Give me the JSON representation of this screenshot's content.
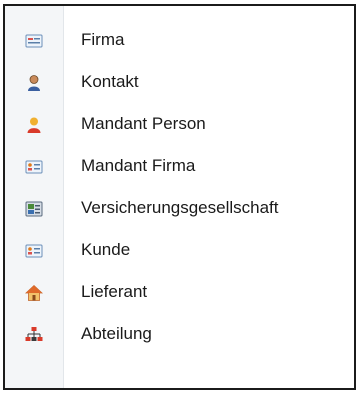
{
  "menu": {
    "items": [
      {
        "label": "Firma",
        "icon": "company-card-icon"
      },
      {
        "label": "Kontakt",
        "icon": "person-icon"
      },
      {
        "label": "Mandant Person",
        "icon": "client-person-icon"
      },
      {
        "label": "Mandant Firma",
        "icon": "client-company-card-icon"
      },
      {
        "label": "Versicherungsgesellschaft",
        "icon": "insurance-company-icon"
      },
      {
        "label": "Kunde",
        "icon": "customer-card-icon"
      },
      {
        "label": "Lieferant",
        "icon": "supplier-house-icon"
      },
      {
        "label": "Abteilung",
        "icon": "org-chart-icon"
      }
    ]
  }
}
